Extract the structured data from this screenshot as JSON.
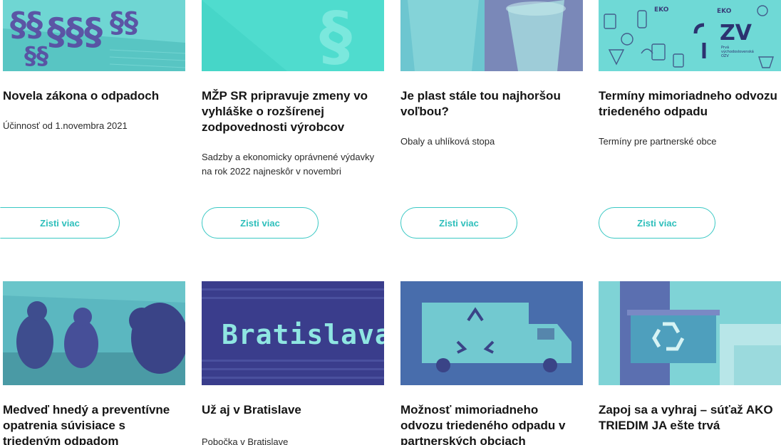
{
  "cards": [
    {
      "title": "Novela zákona o odpadoch",
      "desc": "Účinnosť od 1.novembra 2021",
      "button": "Zisti viac",
      "image": "paragraph-symbols-on-newspaper"
    },
    {
      "title": "MŽP SR pripravuje zmeny vo vyhláške o rozšírenej zodpovednosti výrobcov",
      "desc": "Sadzby a ekonomicky oprávnené výdavky na rok 2022 najneskôr v novembri",
      "button": "Zisti viac",
      "image": "paragraph-symbol"
    },
    {
      "title": "Je plast stále tou najhoršou voľbou?",
      "desc": "Obaly a uhlíková stopa",
      "button": "Zisti viac",
      "image": "plastic-cups"
    },
    {
      "title": "Termíny mimoriadneho odvozu triedeného odpadu",
      "desc": "Termíny pre partnerské obce",
      "button": "Zisti viac",
      "image": "ozv-waste-doodles",
      "image_text": [
        "ZV",
        "Prvá",
        "východoslovenská",
        "OZV",
        "EKO"
      ]
    },
    {
      "title": "Medveď hnedý a preventívne opatrenia súvisiace s triedeným odpadom",
      "desc": "",
      "image": "bears"
    },
    {
      "title": "Už aj v Bratislave",
      "desc": "Pobočka v Bratislave",
      "image": "bratislava-led-sign",
      "image_text": "Bratislava"
    },
    {
      "title": "Možnosť mimoriadneho odvozu triedeného odpadu v partnerských obciach",
      "desc": "",
      "image": "recycling-truck"
    },
    {
      "title": "Zapoj sa a vyhraj – súťaž AKO TRIEDIM JA ešte trvá",
      "desc": "",
      "image": "recycling-box"
    }
  ],
  "colors": {
    "accent": "#39c8c4",
    "image_tint": "#67d1cf",
    "image_shade": "#4a4f9a",
    "text": "#151515"
  }
}
